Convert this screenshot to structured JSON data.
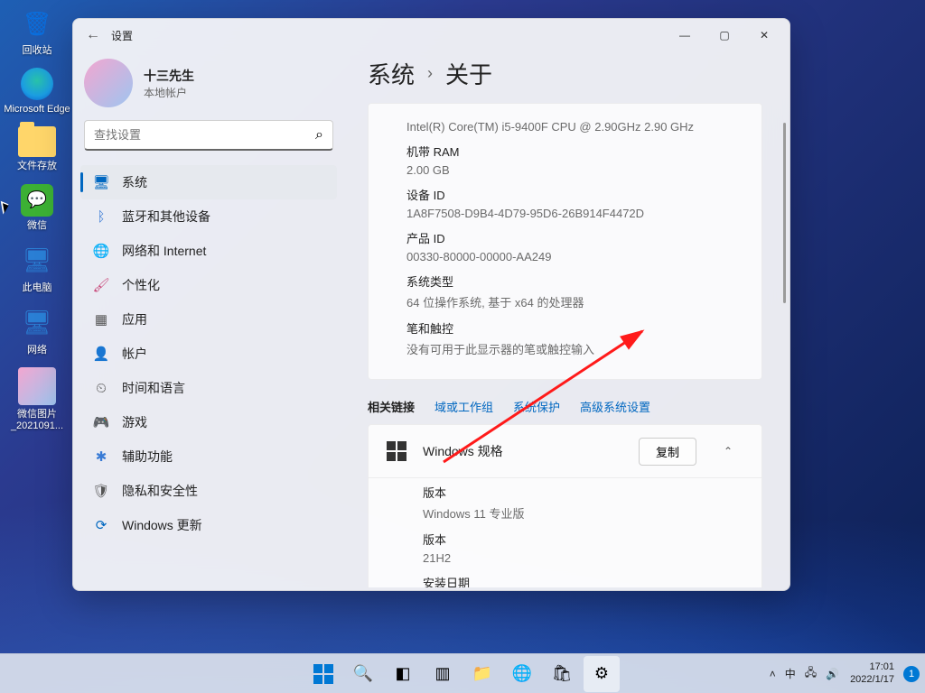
{
  "desktop_icons": {
    "recycle": "回收站",
    "edge": "Microsoft Edge",
    "folder": "文件存放",
    "wechat": "微信",
    "pc": "此电脑",
    "network": "网络",
    "image": "微信图片_2021091..."
  },
  "window": {
    "title": "设置",
    "back_glyph": "←",
    "min_glyph": "—",
    "max_glyph": "▢",
    "close_glyph": "✕"
  },
  "profile": {
    "name": "十三先生",
    "account": "本地帐户"
  },
  "search": {
    "placeholder": "查找设置",
    "icon": "⌕"
  },
  "nav": [
    {
      "icon": "🖥",
      "label": "系统",
      "color": "#0067c0",
      "active": true
    },
    {
      "icon": "ᛒ",
      "label": "蓝牙和其他设备",
      "color": "#3a7bd5"
    },
    {
      "icon": "🌐",
      "label": "网络和 Internet",
      "color": "#2bb3d6"
    },
    {
      "icon": "🖌",
      "label": "个性化",
      "color": "#c94b7b"
    },
    {
      "icon": "▦",
      "label": "应用",
      "color": "#555"
    },
    {
      "icon": "👤",
      "label": "帐户",
      "color": "#3aa0a8"
    },
    {
      "icon": "⏲",
      "label": "时间和语言",
      "color": "#555"
    },
    {
      "icon": "🎮",
      "label": "游戏",
      "color": "#5aa02b"
    },
    {
      "icon": "✱",
      "label": "辅助功能",
      "color": "#3a7bd5"
    },
    {
      "icon": "🛡",
      "label": "隐私和安全性",
      "color": "#555"
    },
    {
      "icon": "⟳",
      "label": "Windows 更新",
      "color": "#0067c0"
    }
  ],
  "crumb": {
    "root": "系统",
    "sep": "›",
    "leaf": "关于"
  },
  "spec": {
    "cpu_val": "Intel(R) Core(TM) i5-9400F CPU @ 2.90GHz   2.90 GHz",
    "ram_label": "机带 RAM",
    "ram_val": "2.00 GB",
    "devid_label": "设备 ID",
    "devid_val": "1A8F7508-D9B4-4D79-95D6-26B914F4472D",
    "prodid_label": "产品 ID",
    "prodid_val": "00330-80000-00000-AA249",
    "systype_label": "系统类型",
    "systype_val": "64 位操作系统, 基于 x64 的处理器",
    "pen_label": "笔和触控",
    "pen_val": "没有可用于此显示器的笔或触控输入"
  },
  "links": {
    "title": "相关链接",
    "l1": "域或工作组",
    "l2": "系统保护",
    "l3": "高级系统设置"
  },
  "winspec": {
    "title": "Windows 规格",
    "copy": "复制",
    "chev": "⌃",
    "edition_label": "版本",
    "edition_val": "Windows 11 专业版",
    "ver_label": "版本",
    "ver_val": "21H2",
    "inst_label": "安装日期"
  },
  "taskbar": {
    "center": [
      {
        "name": "start",
        "glyph": ""
      },
      {
        "name": "search",
        "glyph": "🔍"
      },
      {
        "name": "taskview",
        "glyph": "◧"
      },
      {
        "name": "widgets",
        "glyph": "▥"
      },
      {
        "name": "explorer",
        "glyph": "📁"
      },
      {
        "name": "edge",
        "glyph": "🌐"
      },
      {
        "name": "store",
        "glyph": "🛍"
      },
      {
        "name": "settings",
        "glyph": "⚙",
        "active": true
      }
    ],
    "tray": {
      "chevron": "˄",
      "ime": "中",
      "net": "🖧",
      "vol": "🔊"
    },
    "clock": {
      "time": "17:01",
      "date": "2022/1/17"
    },
    "notif": "1"
  }
}
